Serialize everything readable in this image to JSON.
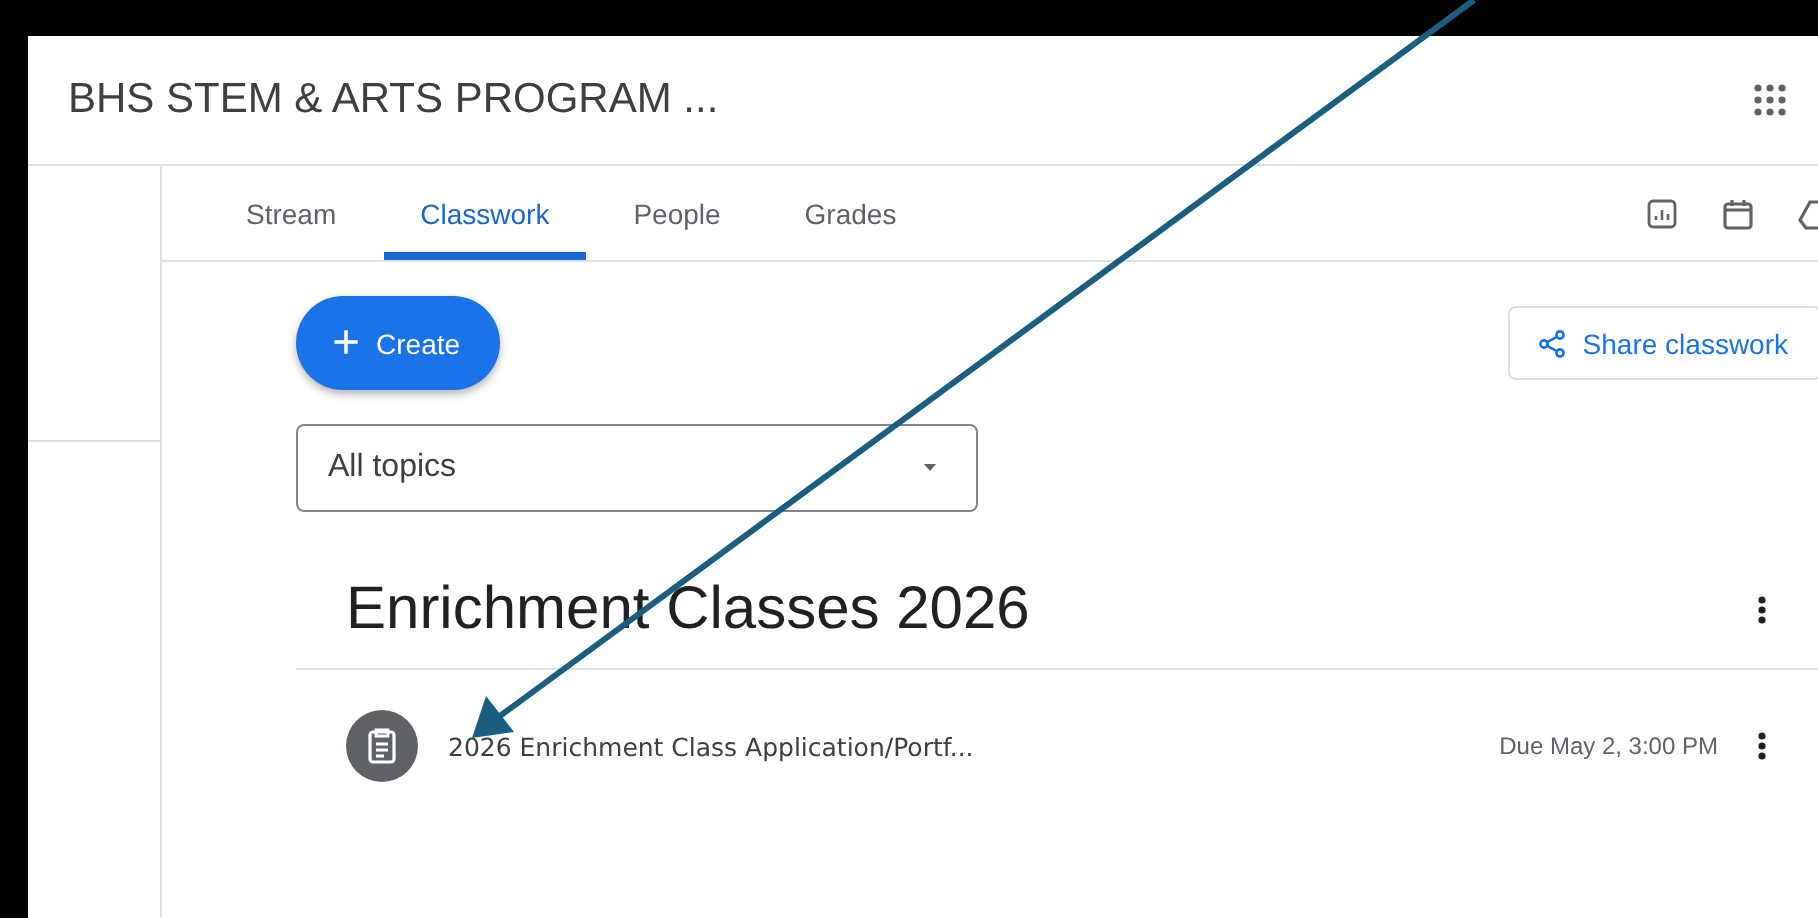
{
  "header": {
    "title": "BHS STEM & ARTS PROGRAM ..."
  },
  "tabs": [
    {
      "label": "Stream",
      "selected": false
    },
    {
      "label": "Classwork",
      "selected": true
    },
    {
      "label": "People",
      "selected": false
    },
    {
      "label": "Grades",
      "selected": false
    }
  ],
  "toolbar": {
    "create_label": "Create",
    "share_label": "Share classwork",
    "plus": "+"
  },
  "topic_filter": {
    "value": "All topics"
  },
  "topic": {
    "title": "Enrichment Classes 2026",
    "items": [
      {
        "title": "2026 Enrichment Class Application/Portf...",
        "due": "Due May 2, 3:00 PM"
      }
    ]
  }
}
